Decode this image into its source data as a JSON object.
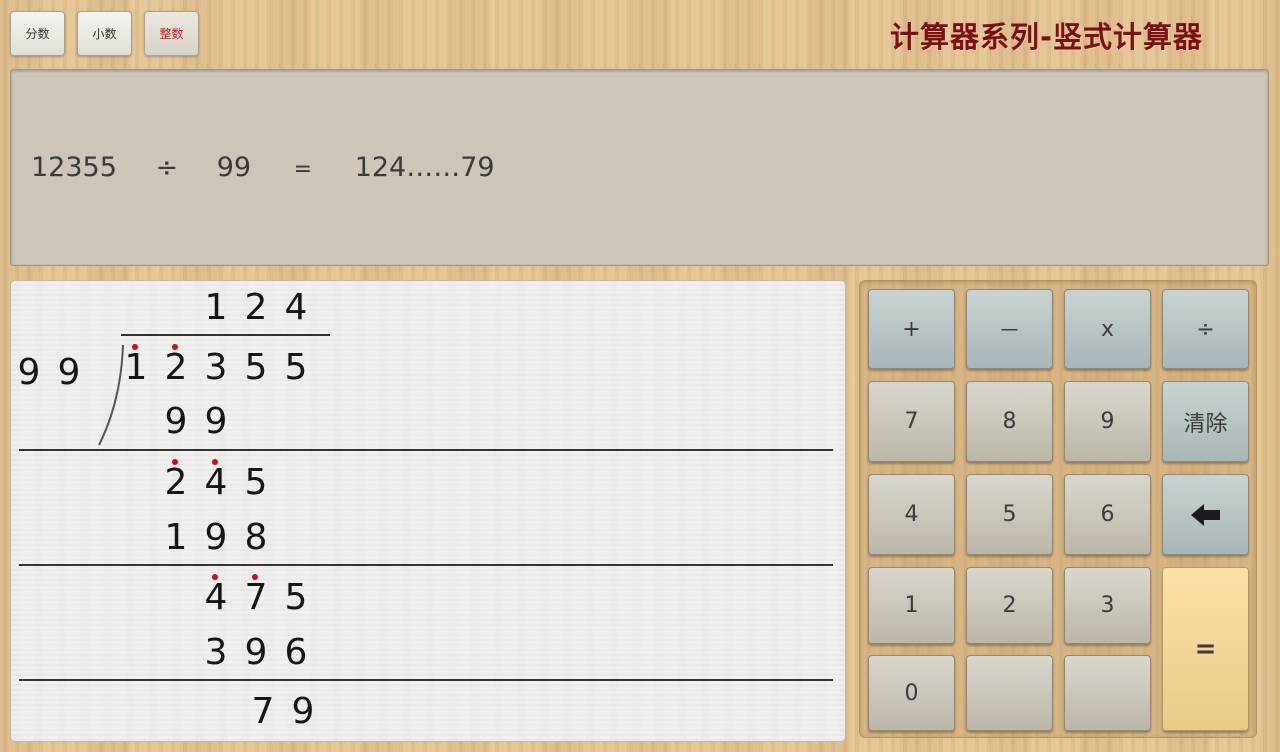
{
  "modes": [
    {
      "label": "分数",
      "active": false
    },
    {
      "label": "小数",
      "active": false
    },
    {
      "label": "整数",
      "active": true
    }
  ],
  "app_title": "计算器系列-竖式计算器",
  "display": {
    "dividend": "12355",
    "operator": "÷",
    "divisor": "99",
    "equals": "=",
    "result": "124……79"
  },
  "long_division": {
    "quotient": [
      "1",
      "2",
      "4"
    ],
    "divisor": [
      "9",
      "9"
    ],
    "dividend": [
      "1",
      "2",
      "3",
      "5",
      "5"
    ],
    "steps": [
      [
        "9",
        "9"
      ],
      [
        "2",
        "4",
        "5"
      ],
      [
        "1",
        "9",
        "8"
      ],
      [
        "4",
        "7",
        "5"
      ],
      [
        "3",
        "9",
        "6"
      ],
      [
        "7",
        "9"
      ]
    ]
  },
  "keypad": {
    "row1": [
      "+",
      "－",
      "x",
      "÷"
    ],
    "row2": [
      "7",
      "8",
      "9",
      "清除"
    ],
    "row3": [
      "4",
      "5",
      "6"
    ],
    "row4": [
      "1",
      "2",
      "3"
    ],
    "row5": [
      "0",
      "",
      ""
    ],
    "backspace_icon": "arrow-left-icon",
    "equals_label": "="
  },
  "colors": {
    "title": "#7b0f14",
    "active_mode": "#d21a1a",
    "borrow_dot": "#cc1010",
    "equals_key": "#f5d698"
  }
}
